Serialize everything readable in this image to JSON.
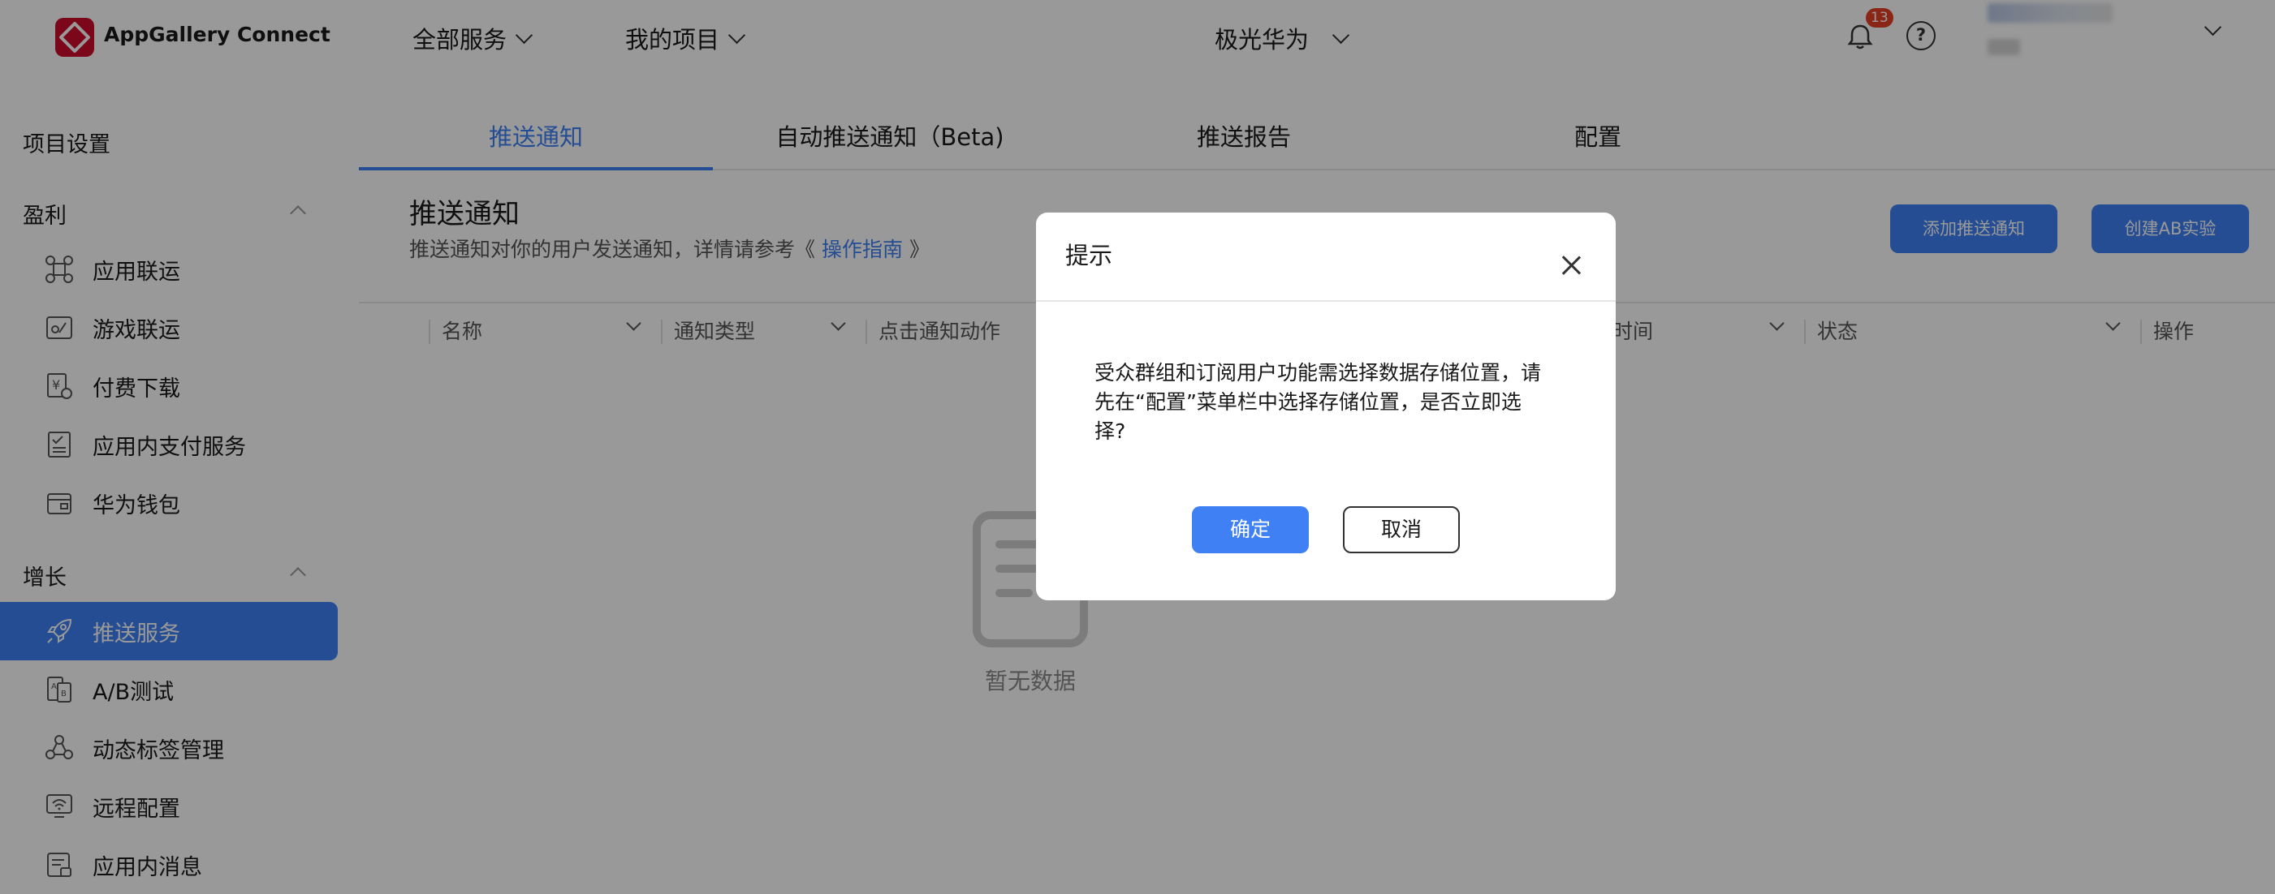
{
  "header": {
    "brand": "AppGallery Connect",
    "nav": [
      "全部服务",
      "我的项目"
    ],
    "project": "极光华为",
    "notification_count": "13",
    "help_symbol": "?"
  },
  "sidebar": {
    "project_settings": "项目设置",
    "groups": [
      {
        "label": "盈利",
        "items": [
          {
            "label": "应用联运",
            "icon": "app-distribution-icon"
          },
          {
            "label": "游戏联运",
            "icon": "game-distribution-icon"
          },
          {
            "label": "付费下载",
            "icon": "paid-download-icon"
          },
          {
            "label": "应用内支付服务",
            "icon": "in-app-payment-icon"
          },
          {
            "label": "华为钱包",
            "icon": "wallet-icon"
          }
        ]
      },
      {
        "label": "增长",
        "items": [
          {
            "label": "推送服务",
            "icon": "rocket-icon",
            "active": true
          },
          {
            "label": "A/B测试",
            "icon": "ab-test-icon"
          },
          {
            "label": "动态标签管理",
            "icon": "tag-management-icon"
          },
          {
            "label": "远程配置",
            "icon": "remote-config-icon"
          },
          {
            "label": "应用内消息",
            "icon": "in-app-message-icon"
          }
        ]
      }
    ]
  },
  "tabs": [
    "推送通知",
    "自动推送通知（Beta)",
    "推送报告",
    "配置"
  ],
  "page": {
    "title": "推送通知",
    "desc_prefix": "推送通知对你的用户发送通知，详情请参考《",
    "desc_link": "操作指南",
    "desc_suffix": "》",
    "add_button": "添加推送通知",
    "ab_button": "创建AB实验"
  },
  "table": {
    "columns": [
      "名称",
      "通知类型",
      "点击通知动作",
      "时间",
      "状态",
      "操作"
    ],
    "empty_text": "暂无数据"
  },
  "dialog": {
    "title": "提示",
    "message": "受众群组和订阅用户功能需选择数据存储位置，请先在“配置”菜单栏中选择存储位置，是否立即选择?",
    "ok": "确定",
    "cancel": "取消"
  },
  "colors": {
    "primary": "#3f81f5",
    "brand_red": "#cf0a2c",
    "badge": "#e84026"
  }
}
